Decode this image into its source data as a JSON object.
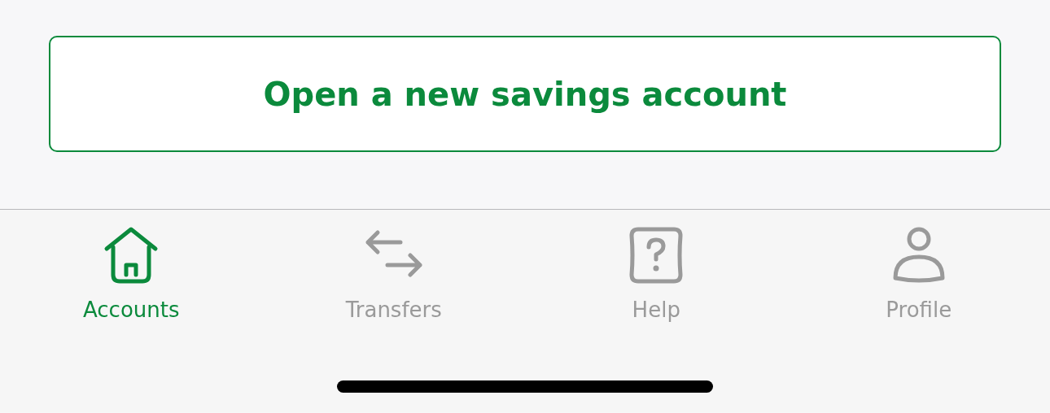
{
  "action_button": {
    "label": "Open a new savings account"
  },
  "tabs": [
    {
      "label": "Accounts",
      "selected": true,
      "kind": "home"
    },
    {
      "label": "Transfers",
      "selected": false,
      "kind": "transfer"
    },
    {
      "label": "Help",
      "selected": false,
      "kind": "help"
    },
    {
      "label": "Profile",
      "selected": false,
      "kind": "profile"
    }
  ]
}
